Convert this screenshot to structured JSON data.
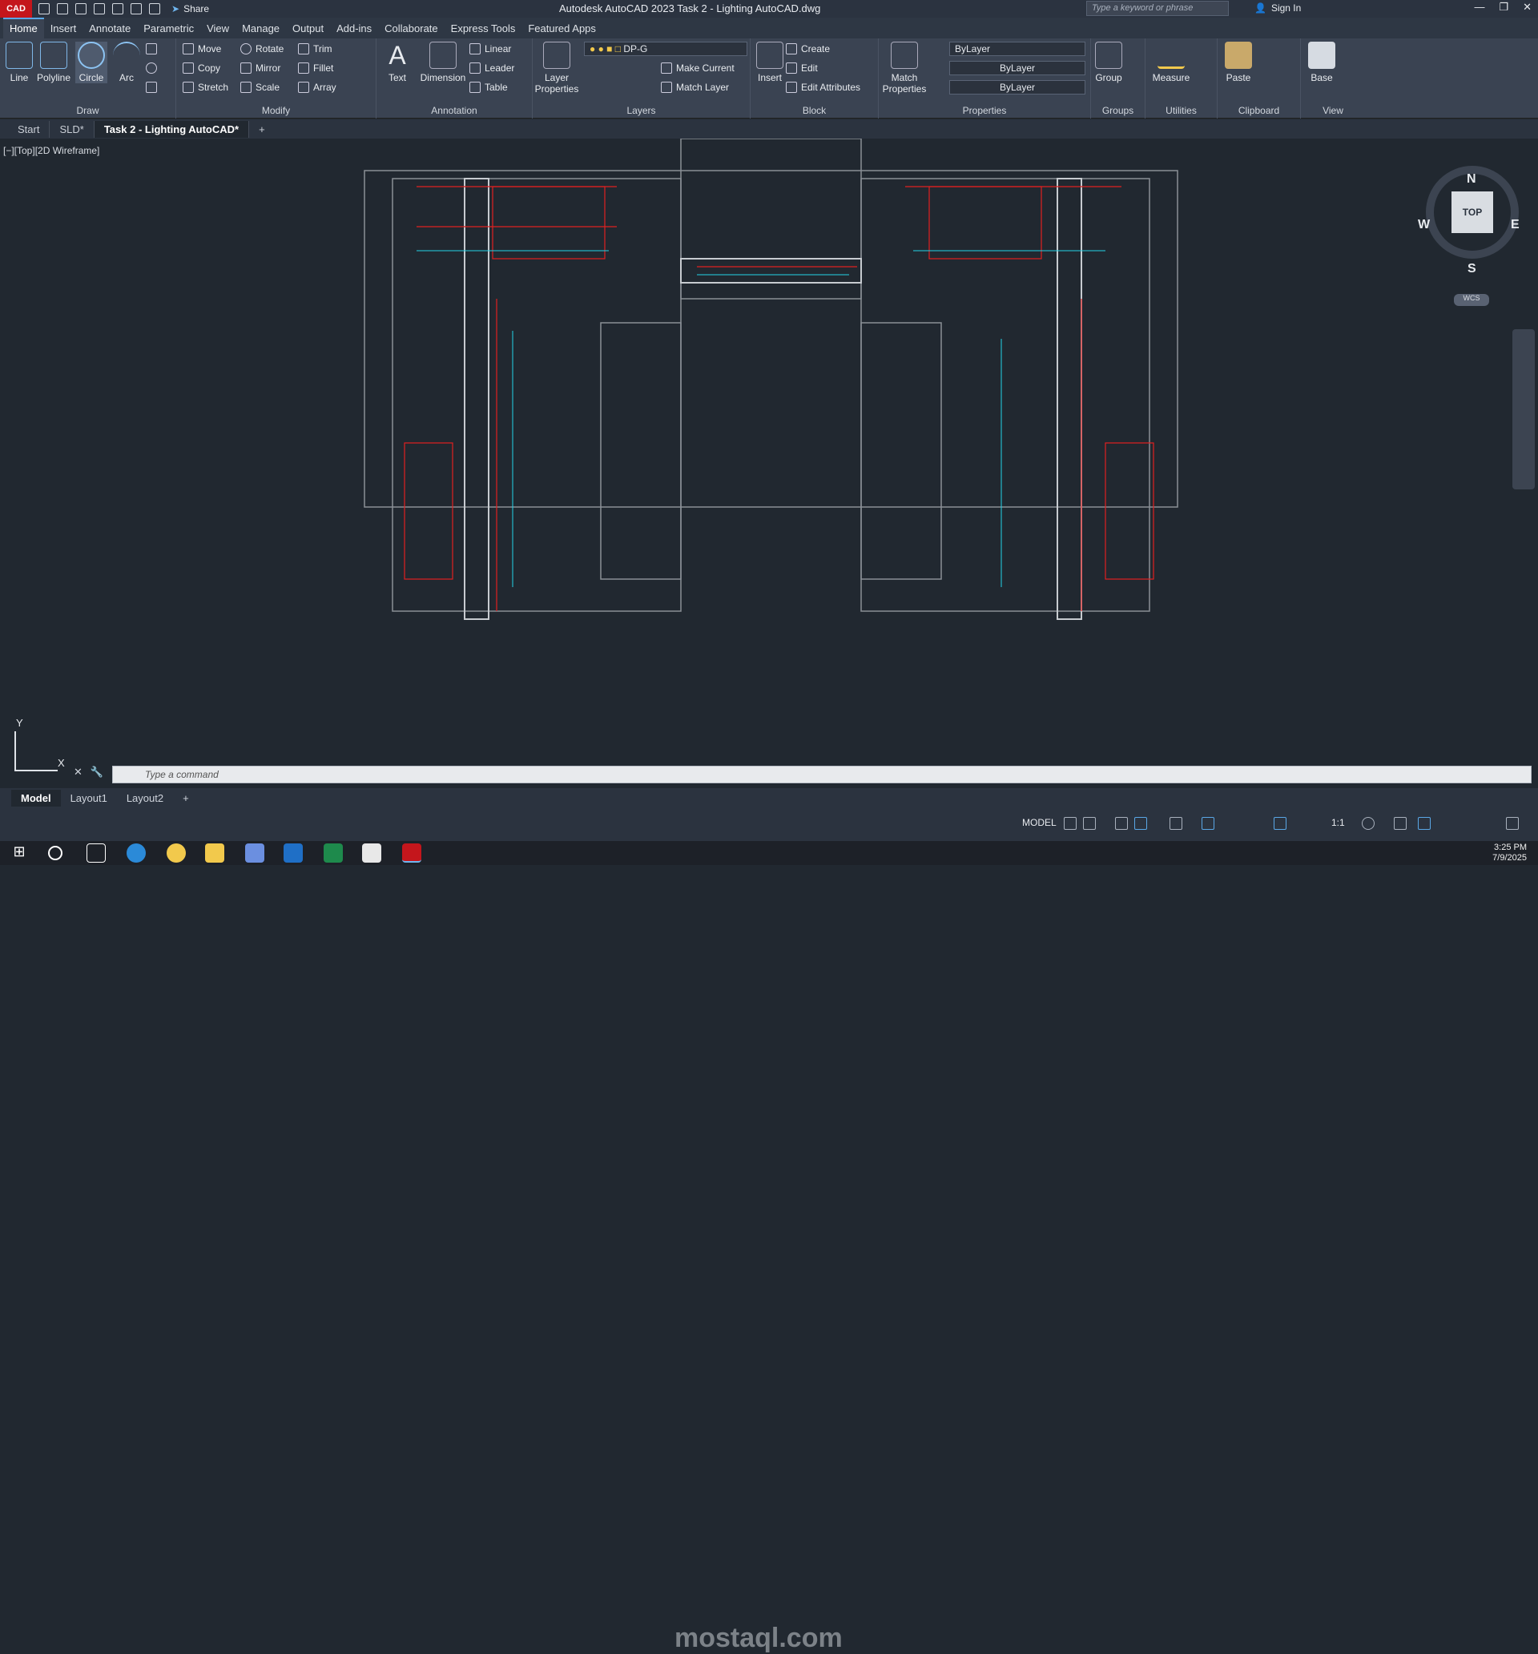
{
  "app": {
    "badge": "CAD",
    "title": "Autodesk AutoCAD 2023    Task 2 - Lighting AutoCAD.dwg",
    "search_placeholder": "Type a keyword or phrase",
    "share": "Share",
    "sign_in": "Sign In"
  },
  "ribbon_tabs": [
    "Home",
    "Insert",
    "Annotate",
    "Parametric",
    "View",
    "Manage",
    "Output",
    "Add-ins",
    "Collaborate",
    "Express Tools",
    "Featured Apps"
  ],
  "ribbon": {
    "draw": {
      "label": "Draw",
      "line": "Line",
      "polyline": "Polyline",
      "circle": "Circle",
      "arc": "Arc"
    },
    "modify": {
      "label": "Modify",
      "move": "Move",
      "rotate": "Rotate",
      "trim": "Trim",
      "copy": "Copy",
      "mirror": "Mirror",
      "fillet": "Fillet",
      "stretch": "Stretch",
      "scale": "Scale",
      "array": "Array"
    },
    "annotation": {
      "label": "Annotation",
      "text": "Text",
      "dimension": "Dimension",
      "linear": "Linear",
      "leader": "Leader",
      "table": "Table"
    },
    "layers": {
      "label": "Layers",
      "layer_properties": "Layer Properties",
      "current_layer": "DP-G",
      "make_current": "Make Current",
      "match_layer": "Match Layer"
    },
    "block": {
      "label": "Block",
      "insert": "Insert",
      "create": "Create",
      "edit": "Edit",
      "edit_attributes": "Edit Attributes"
    },
    "properties": {
      "label": "Properties",
      "match_properties": "Match Properties",
      "color": "ByLayer",
      "linetype": "ByLayer",
      "lineweight": "ByLayer"
    },
    "groups": {
      "label": "Groups",
      "group": "Group"
    },
    "utilities": {
      "label": "Utilities",
      "measure": "Measure"
    },
    "clipboard": {
      "label": "Clipboard",
      "paste": "Paste"
    },
    "view": {
      "label": "View",
      "base": "Base"
    }
  },
  "doc_tabs": [
    "Start",
    "SLD*",
    "Task 2 - Lighting AutoCAD*"
  ],
  "viewport": {
    "label": "[−][Top][2D Wireframe]",
    "compass": {
      "n": "N",
      "s": "S",
      "e": "E",
      "w": "W",
      "top": "TOP",
      "wcs": "WCS"
    },
    "ucs_x": "X",
    "ucs_y": "Y"
  },
  "command": {
    "placeholder": "Type a command"
  },
  "layout_tabs": [
    "Model",
    "Layout1",
    "Layout2"
  ],
  "status": {
    "model": "MODEL",
    "scale": "1:1"
  },
  "taskbar": {
    "time": "3:25 PM",
    "date": "7/9/2025"
  },
  "watermark": "mostaql.com"
}
